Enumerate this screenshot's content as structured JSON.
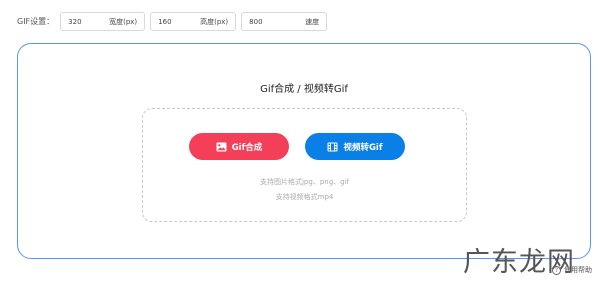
{
  "settings": {
    "label": "GIF设置：",
    "fields": [
      {
        "value": "320",
        "unit": "宽度(px)"
      },
      {
        "value": "160",
        "unit": "高度(px)"
      },
      {
        "value": "800",
        "unit": "速度"
      }
    ]
  },
  "panel": {
    "title": "Gif合成 / 视频转Gif",
    "gif_button": {
      "label": "Gif合成",
      "icon": "image-icon",
      "color": "#f33f58"
    },
    "video_button": {
      "label": "视频转Gif",
      "icon": "film-icon",
      "color": "#0a7fe6"
    },
    "hint_images": "支持图片格式jpg、png、gif",
    "hint_video": "支持视频格式mp4"
  },
  "watermark": "广东龙网",
  "help": {
    "icon": "question-circle-icon",
    "label": "使用帮助"
  },
  "colors": {
    "panel_border": "#5b93f2"
  }
}
